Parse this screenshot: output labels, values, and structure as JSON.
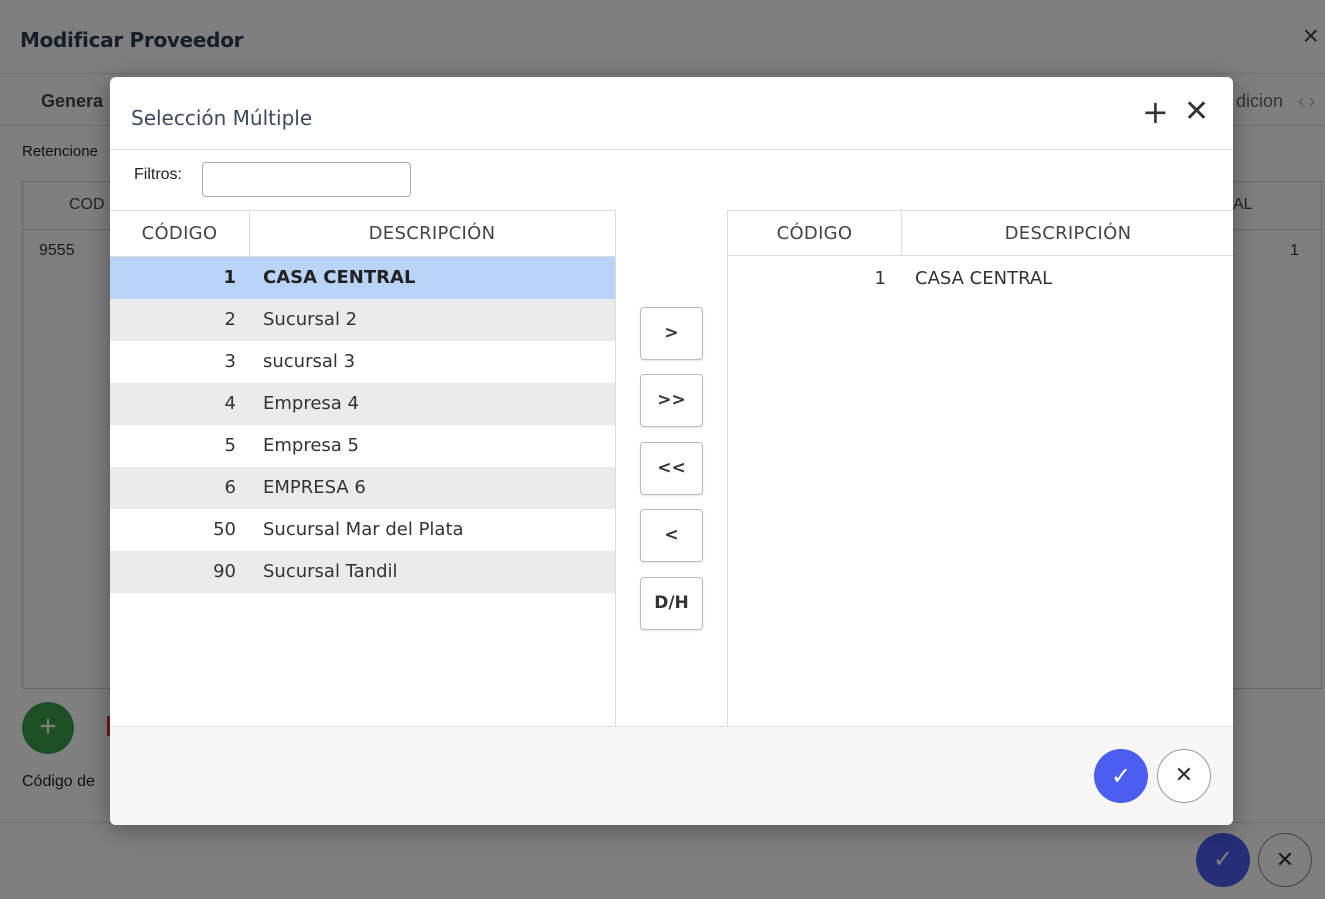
{
  "background_dialog": {
    "title": "Modificar Proveedor",
    "close_icon": "×",
    "tab_general": "Genera",
    "tab_adicion": "dicion",
    "tab_arrows": "‹ ›",
    "section_label": "Retencione",
    "table_header_cod": "COD",
    "table_header_al": "AL",
    "row_code": "9555",
    "row_value": "1",
    "add_icon": "+",
    "codigo_label": "Código de",
    "ok_icon": "✓",
    "cancel_icon": "✕"
  },
  "modal": {
    "title": "Selección Múltiple",
    "plus_icon": "+",
    "close_icon": "✕",
    "filter_label": "Filtros:",
    "filter_value": "",
    "left_table": {
      "headers": {
        "code": "CÓDIGO",
        "description": "DESCRIPCIÓN"
      },
      "rows": [
        {
          "code": "1",
          "description": "CASA CENTRAL",
          "selected": true
        },
        {
          "code": "2",
          "description": "Sucursal 2"
        },
        {
          "code": "3",
          "description": "sucursal 3"
        },
        {
          "code": "4",
          "description": "Empresa 4"
        },
        {
          "code": "5",
          "description": "Empresa 5"
        },
        {
          "code": "6",
          "description": "EMPRESA 6"
        },
        {
          "code": "50",
          "description": "Sucursal Mar del Plata"
        },
        {
          "code": "90",
          "description": "Sucursal Tandil"
        }
      ]
    },
    "right_table": {
      "headers": {
        "code": "CÓDIGO",
        "description": "DESCRIPCIÓN"
      },
      "rows": [
        {
          "code": "1",
          "description": "CASA CENTRAL"
        }
      ]
    },
    "transfer_buttons": {
      "move_selected": ">",
      "move_all": ">>",
      "remove_all": "<<",
      "remove_selected": "<",
      "dh": "D/H"
    },
    "footer": {
      "ok_icon": "✓",
      "cancel_icon": "✕"
    }
  },
  "colors": {
    "selected_row": "#b9d4f7",
    "primary_button": "#4b5ef0",
    "add_button": "#3aa04a",
    "stripe": "#ebebeb"
  }
}
